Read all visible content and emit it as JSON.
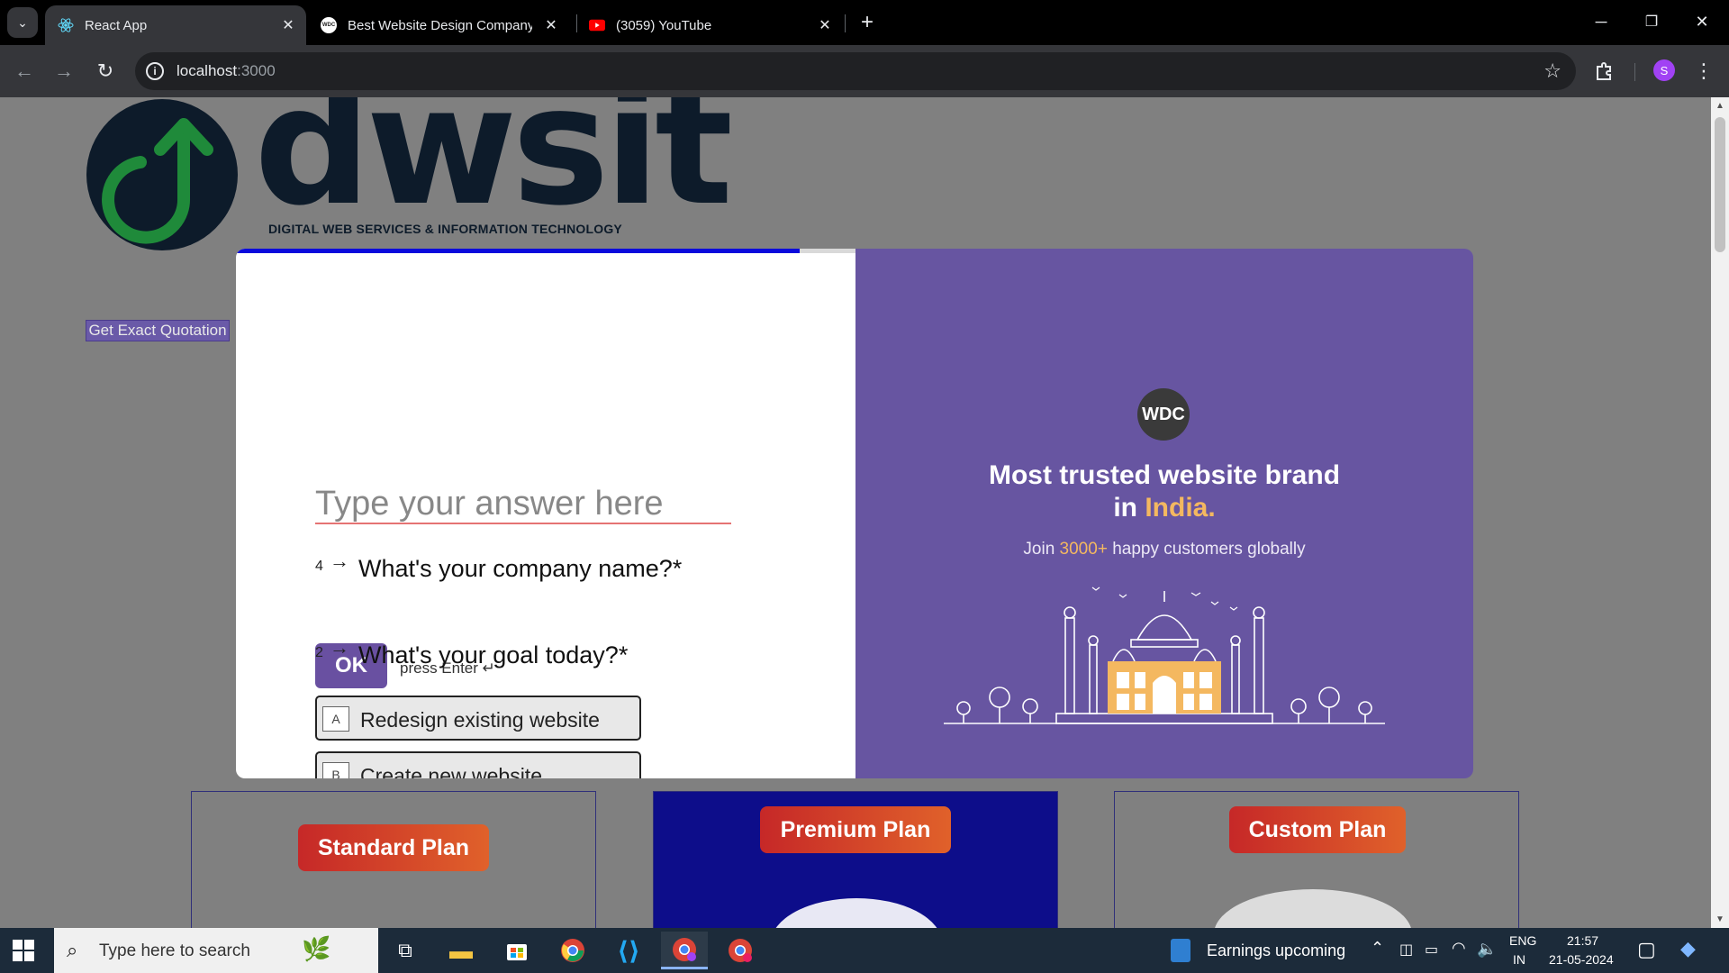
{
  "browser": {
    "tabs": [
      {
        "title": "React App",
        "icon": "react-icon",
        "active": true
      },
      {
        "title": "Best Website Design Company",
        "icon": "wdc-icon",
        "active": false
      },
      {
        "title": "(3059) YouTube",
        "icon": "youtube-icon",
        "active": false
      }
    ],
    "url_host": "localhost",
    "url_port": ":3000",
    "profile_initial": "S"
  },
  "page": {
    "logo_wordmark": "dwsit",
    "logo_subtitle": "DIGITAL WEB SERVICES & INFORMATION TECHNOLOGY",
    "quote_button": "Get Exact Quotation"
  },
  "form": {
    "progress": 0.91,
    "q4": {
      "number": "4",
      "arrow": "→",
      "text": "What's your company name?*",
      "placeholder": "Type your answer here"
    },
    "q2": {
      "number": "2",
      "arrow": "→",
      "text": "What's your goal today?*"
    },
    "ok_label": "OK",
    "press_enter": "press Enter ↵",
    "choices": [
      {
        "key": "A",
        "label": "Redesign existing website"
      },
      {
        "key": "B",
        "label": "Create new website"
      }
    ]
  },
  "promo": {
    "badge": "WDC",
    "headline_part1": "Most trusted website brand",
    "headline_in": "in ",
    "headline_highlight": "India.",
    "join_prefix": "Join ",
    "join_count": "3000+",
    "join_suffix": " happy customers globally",
    "accent_color": "#f4b860",
    "background_color": "#6755a1"
  },
  "plans": [
    {
      "label": "Standard Plan"
    },
    {
      "label": "Premium Plan"
    },
    {
      "label": "Custom Plan"
    }
  ],
  "taskbar": {
    "search_placeholder": "Type here to search",
    "news": "Earnings upcoming",
    "lang1": "ENG",
    "lang2": "IN",
    "time": "21:57",
    "date": "21-05-2024"
  }
}
